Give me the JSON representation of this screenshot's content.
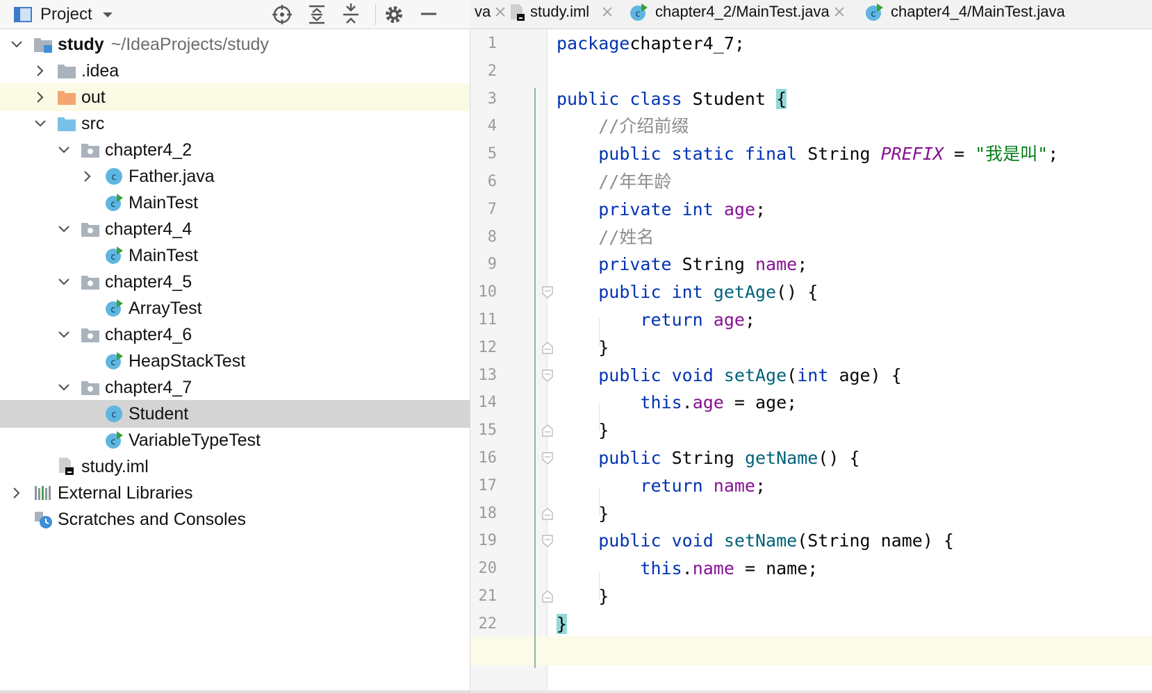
{
  "project_panel": {
    "title": "Project",
    "tree": [
      {
        "label": "study",
        "path": "~/IdeaProjects/study",
        "depth": 0,
        "arrow": "down",
        "icon": "module-folder-icon",
        "state": ""
      },
      {
        "label": ".idea",
        "depth": 1,
        "arrow": "right",
        "icon": "folder-icon",
        "state": ""
      },
      {
        "label": "out",
        "depth": 1,
        "arrow": "right",
        "icon": "excluded-folder-icon",
        "state": "highlighted"
      },
      {
        "label": "src",
        "depth": 1,
        "arrow": "down",
        "icon": "source-folder-icon",
        "state": ""
      },
      {
        "label": "chapter4_2",
        "depth": 2,
        "arrow": "down",
        "icon": "package-icon",
        "state": ""
      },
      {
        "label": "Father.java",
        "depth": 3,
        "arrow": "right",
        "icon": "class-icon",
        "state": ""
      },
      {
        "label": "MainTest",
        "depth": 3,
        "arrow": "",
        "icon": "runnable-class-icon",
        "state": ""
      },
      {
        "label": "chapter4_4",
        "depth": 2,
        "arrow": "down",
        "icon": "package-icon",
        "state": ""
      },
      {
        "label": "MainTest",
        "depth": 3,
        "arrow": "",
        "icon": "runnable-class-icon",
        "state": ""
      },
      {
        "label": "chapter4_5",
        "depth": 2,
        "arrow": "down",
        "icon": "package-icon",
        "state": ""
      },
      {
        "label": "ArrayTest",
        "depth": 3,
        "arrow": "",
        "icon": "runnable-class-icon",
        "state": ""
      },
      {
        "label": "chapter4_6",
        "depth": 2,
        "arrow": "down",
        "icon": "package-icon",
        "state": ""
      },
      {
        "label": "HeapStackTest",
        "depth": 3,
        "arrow": "",
        "icon": "runnable-class-icon",
        "state": ""
      },
      {
        "label": "chapter4_7",
        "depth": 2,
        "arrow": "down",
        "icon": "package-icon",
        "state": ""
      },
      {
        "label": "Student",
        "depth": 3,
        "arrow": "",
        "icon": "class-icon",
        "state": "selected"
      },
      {
        "label": "VariableTypeTest",
        "depth": 3,
        "arrow": "",
        "icon": "runnable-class-icon",
        "state": ""
      },
      {
        "label": "study.iml",
        "depth": 1,
        "arrow": "",
        "icon": "iml-file-icon",
        "state": ""
      },
      {
        "label": "External Libraries",
        "depth": 0,
        "arrow": "right",
        "icon": "libraries-icon",
        "state": ""
      },
      {
        "label": "Scratches and Consoles",
        "depth": 0,
        "arrow": "",
        "icon": "scratches-icon",
        "state": ""
      }
    ]
  },
  "tabs": [
    {
      "label": "va",
      "icon": ""
    },
    {
      "label": "study.iml",
      "icon": "iml-file-icon"
    },
    {
      "label": "chapter4_2/MainTest.java",
      "icon": "runnable-class-icon"
    },
    {
      "label": "chapter4_4/MainTest.java",
      "icon": "runnable-class-icon"
    }
  ],
  "editor": {
    "current_line": 22,
    "lines": [
      [
        [
          "kw",
          "package"
        ],
        [
          "",
          "chapter4_7;"
        ]
      ],
      [],
      [
        [
          "kw",
          "public class "
        ],
        [
          "cls",
          "Student "
        ],
        [
          "brace-hl",
          "{"
        ]
      ],
      [
        [
          "",
          "    "
        ],
        [
          "cmt",
          "//介绍前缀"
        ]
      ],
      [
        [
          "",
          "    "
        ],
        [
          "kw",
          "public static final "
        ],
        [
          "",
          "String "
        ],
        [
          "static",
          "PREFIX"
        ],
        [
          "",
          " = "
        ],
        [
          "str",
          "\"我是叫\""
        ],
        [
          "",
          ";"
        ]
      ],
      [
        [
          "",
          "    "
        ],
        [
          "cmt",
          "//年年龄"
        ]
      ],
      [
        [
          "",
          "    "
        ],
        [
          "kw",
          "private int "
        ],
        [
          "field",
          "age"
        ],
        [
          "",
          ";"
        ]
      ],
      [
        [
          "",
          "    "
        ],
        [
          "cmt",
          "//姓名"
        ]
      ],
      [
        [
          "",
          "    "
        ],
        [
          "kw",
          "private "
        ],
        [
          "",
          "String "
        ],
        [
          "field",
          "name"
        ],
        [
          "",
          ";"
        ]
      ],
      [
        [
          "",
          "    "
        ],
        [
          "kw",
          "public int "
        ],
        [
          "meth",
          "getAge"
        ],
        [
          "",
          "() {"
        ]
      ],
      [
        [
          "",
          "        "
        ],
        [
          "kw",
          "return "
        ],
        [
          "field",
          "age"
        ],
        [
          "",
          ";"
        ]
      ],
      [
        [
          "",
          "    }"
        ]
      ],
      [
        [
          "",
          "    "
        ],
        [
          "kw",
          "public void "
        ],
        [
          "meth",
          "setAge"
        ],
        [
          "",
          "("
        ],
        [
          "kw",
          "int "
        ],
        [
          "",
          "age) {"
        ]
      ],
      [
        [
          "",
          "        "
        ],
        [
          "kw",
          "this"
        ],
        [
          "",
          "."
        ],
        [
          "field",
          "age"
        ],
        [
          "",
          " = age;"
        ]
      ],
      [
        [
          "",
          "    }"
        ]
      ],
      [
        [
          "",
          "    "
        ],
        [
          "kw",
          "public "
        ],
        [
          "",
          "String "
        ],
        [
          "meth",
          "getName"
        ],
        [
          "",
          "() {"
        ]
      ],
      [
        [
          "",
          "        "
        ],
        [
          "kw",
          "return "
        ],
        [
          "field",
          "name"
        ],
        [
          "",
          ";"
        ]
      ],
      [
        [
          "",
          "    }"
        ]
      ],
      [
        [
          "",
          "    "
        ],
        [
          "kw",
          "public void "
        ],
        [
          "meth",
          "setName"
        ],
        [
          "",
          "(String name) {"
        ]
      ],
      [
        [
          "",
          "        "
        ],
        [
          "kw",
          "this"
        ],
        [
          "",
          "."
        ],
        [
          "field",
          "name"
        ],
        [
          "",
          " = name;"
        ]
      ],
      [
        [
          "",
          "    }"
        ]
      ],
      [
        [
          "brace-hl",
          "}"
        ]
      ]
    ]
  }
}
